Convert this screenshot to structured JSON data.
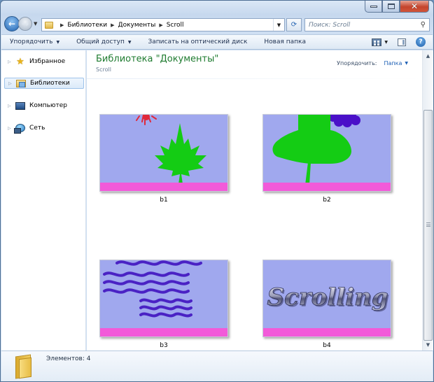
{
  "address": {
    "crumbs": [
      "Библиотеки",
      "Документы",
      "Scroll"
    ]
  },
  "search": {
    "placeholder": "Поиск: Scroll"
  },
  "toolbar": {
    "organize": "Упорядочить",
    "share": "Общий доступ",
    "burn": "Записать на оптический диск",
    "new_folder": "Новая папка"
  },
  "navpane": {
    "items": [
      {
        "label": "Избранное",
        "icon": "star-icon"
      },
      {
        "label": "Библиотеки",
        "icon": "libraries-icon"
      },
      {
        "label": "Компьютер",
        "icon": "computer-icon"
      },
      {
        "label": "Сеть",
        "icon": "network-icon"
      }
    ]
  },
  "content": {
    "title": "Библиотека \"Документы\"",
    "subtitle": "Scroll",
    "arrange_label": "Упорядочить:",
    "arrange_value": "Папка",
    "files": [
      {
        "name": "b1",
        "picture": "maple-leaf-and-red-sun"
      },
      {
        "name": "b2",
        "picture": "mushroom-tree-and-purple-cloud"
      },
      {
        "name": "b3",
        "picture": "purple-waves"
      },
      {
        "name": "b4",
        "picture": "scrolling-text"
      }
    ],
    "b4_art_text": "Scrolling"
  },
  "details": {
    "count": "Элементов: 4"
  },
  "colors": {
    "accent_title": "#1e7b2f",
    "thumb_bg": "#a0a8ee",
    "thumb_band": "#f25ad9",
    "leaf_green": "#14cc14",
    "wave_purple": "#4a22c4"
  }
}
